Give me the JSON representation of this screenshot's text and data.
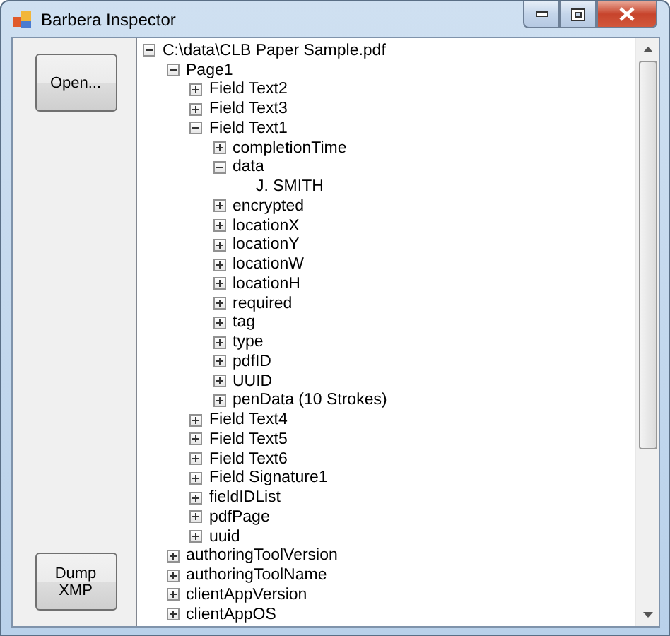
{
  "window": {
    "title": "Barbera Inspector"
  },
  "buttons": [
    "Open...",
    "Dump XMP"
  ],
  "tree": [
    {
      "label": "C:\\data\\CLB Paper Sample.pdf",
      "expanded": true,
      "children": [
        {
          "label": "Page1",
          "expanded": true,
          "children": [
            {
              "label": "Field Text2",
              "expanded": false
            },
            {
              "label": "Field Text3",
              "expanded": false
            },
            {
              "label": "Field Text1",
              "expanded": true,
              "children": [
                {
                  "label": "completionTime",
                  "expanded": false
                },
                {
                  "label": "data",
                  "expanded": true,
                  "children": [
                    {
                      "label": "J. SMITH"
                    }
                  ]
                },
                {
                  "label": "encrypted",
                  "expanded": false
                },
                {
                  "label": "locationX",
                  "expanded": false
                },
                {
                  "label": "locationY",
                  "expanded": false
                },
                {
                  "label": "locationW",
                  "expanded": false
                },
                {
                  "label": "locationH",
                  "expanded": false
                },
                {
                  "label": "required",
                  "expanded": false
                },
                {
                  "label": "tag",
                  "expanded": false
                },
                {
                  "label": "type",
                  "expanded": false
                },
                {
                  "label": "pdfID",
                  "expanded": false
                },
                {
                  "label": "UUID",
                  "expanded": false
                },
                {
                  "label": "penData (10 Strokes)",
                  "expanded": false
                }
              ]
            },
            {
              "label": "Field Text4",
              "expanded": false
            },
            {
              "label": "Field Text5",
              "expanded": false
            },
            {
              "label": "Field Text6",
              "expanded": false
            },
            {
              "label": "Field Signature1",
              "expanded": false
            },
            {
              "label": "fieldIDList",
              "expanded": false
            },
            {
              "label": "pdfPage",
              "expanded": false
            },
            {
              "label": "uuid",
              "expanded": false
            }
          ]
        },
        {
          "label": "authoringToolVersion",
          "expanded": false
        },
        {
          "label": "authoringToolName",
          "expanded": false
        },
        {
          "label": "clientAppVersion",
          "expanded": false
        },
        {
          "label": "clientAppOS",
          "expanded": false
        }
      ]
    }
  ]
}
